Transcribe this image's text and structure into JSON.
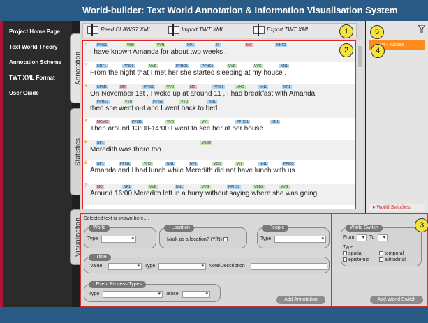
{
  "app": {
    "title": "World-builder: Text World Annotation & Information Visualisation System"
  },
  "sidebar": {
    "items": [
      {
        "label": "Project Home Page"
      },
      {
        "label": "Text World Theory"
      },
      {
        "label": "Annotation Scheme"
      },
      {
        "label": "TWT XML Format"
      },
      {
        "label": "User Guide"
      }
    ]
  },
  "tabs": {
    "annotation": "Annotation",
    "statistics": "Statistics",
    "visualisation": "Visualisation"
  },
  "toolbar": {
    "read_label": "Read CLAWS7 XML",
    "import_label": "Import TWT XML",
    "export_label": "Export TWT XML"
  },
  "markers": [
    "1",
    "2",
    "3",
    "4",
    "5"
  ],
  "sentences": [
    {
      "num": "1",
      "text": "I   have known Amanda for about two weeks  .",
      "tags": [
        "PPIS1",
        "VH0",
        "VVN",
        "NP1",
        "IF",
        "MC",
        "NNT2"
      ]
    },
    {
      "num": "2",
      "text": "From the night that  I  met  her  she  started sleeping at my house  .",
      "tags": [
        "NNT1",
        "PPIS1",
        "VVD",
        "PPHO1",
        "PPHS1",
        "VVD",
        "VVG",
        "NN1"
      ]
    },
    {
      "num": "3",
      "text": "On November 1st ,  I  woke  up at around 11 ,  I  had breakfast with Amanda",
      "text2": "then  she  went out and   I   went back to bed  .",
      "tags": [
        "NPM1",
        "MD",
        "PPIS1",
        "VVD",
        "MC",
        "PPIS1",
        "VHD",
        "NN1",
        "NP1"
      ],
      "tags2": [
        "PPHS1",
        "VVD",
        "PPIS1",
        "VVD",
        "NN1"
      ]
    },
    {
      "num": "4",
      "text": "Then around 13:00-14:00   I   went to see  her  at her house  .",
      "tags": [
        "MCMC",
        "PPIS1",
        "VVD",
        "VVI",
        "PPHO1",
        "NN1"
      ]
    },
    {
      "num": "5",
      "text": "Meredith was there too  .",
      "tags": [
        "NP1",
        "VBDZ"
      ]
    },
    {
      "num": "6",
      "text": "Amanda and   I   had lunch while Meredith did not have lunch with us  .",
      "tags": [
        "NP1",
        "PPIS1",
        "VHD",
        "NN1",
        "NP1",
        "VDD",
        "VHI",
        "NN1",
        "PPIO2"
      ]
    },
    {
      "num": "7",
      "text": "Around 16:00 Meredith left  in  a  hurry without saying where  she  was going  .",
      "tags": [
        "MC",
        "NP1",
        "VVD",
        "NN1",
        "VVG",
        "PPHS1",
        "VBDZ",
        "VVG"
      ]
    }
  ],
  "right_panel": {
    "twt_nodes": "TWT Nodes",
    "world_switches": "World Switches"
  },
  "form": {
    "selected_text": "Selected text is shown here....",
    "world": "World",
    "type": "Type",
    "location": "Location",
    "mark_location": "Mark as a location? (Y/N)",
    "people": "People",
    "time": "Time",
    "value": "Value",
    "note": "Note/Description",
    "event": "Event Process Types",
    "tense": "Tense",
    "add_annotation": "Add Annotation",
    "world_switch": "World Switch",
    "from": "From",
    "to": "To",
    "spatial": "spatial",
    "temporal": "temporal",
    "epistemic": "epistemic",
    "attitudinal": "attitudinal",
    "add_world_switch": "Add World Switch"
  },
  "colors": {
    "header": "#2a5b86",
    "accent_red": "#b0143b",
    "orange": "#ff8c1a",
    "marker_yellow": "#f5e23a"
  }
}
